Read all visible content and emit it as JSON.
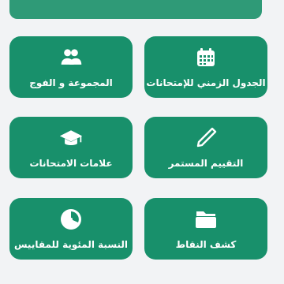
{
  "tiles": [
    {
      "label": "المجموعة و الفوج",
      "icon": "group-icon"
    },
    {
      "label": "الجدول الزمني للإمتحانات",
      "icon": "calendar-icon"
    },
    {
      "label": "علامات الامتحانات",
      "icon": "graduation-cap-icon"
    },
    {
      "label": "التقييم المستمر",
      "icon": "pencil-icon"
    },
    {
      "label": "النسبة المئوية للمقاييس",
      "icon": "pie-chart-icon"
    },
    {
      "label": "كشف النقاط",
      "icon": "folder-icon"
    }
  ],
  "colors": {
    "tile": "#18906b",
    "background": "#f2f3f5",
    "strip": "#2f9a77"
  }
}
